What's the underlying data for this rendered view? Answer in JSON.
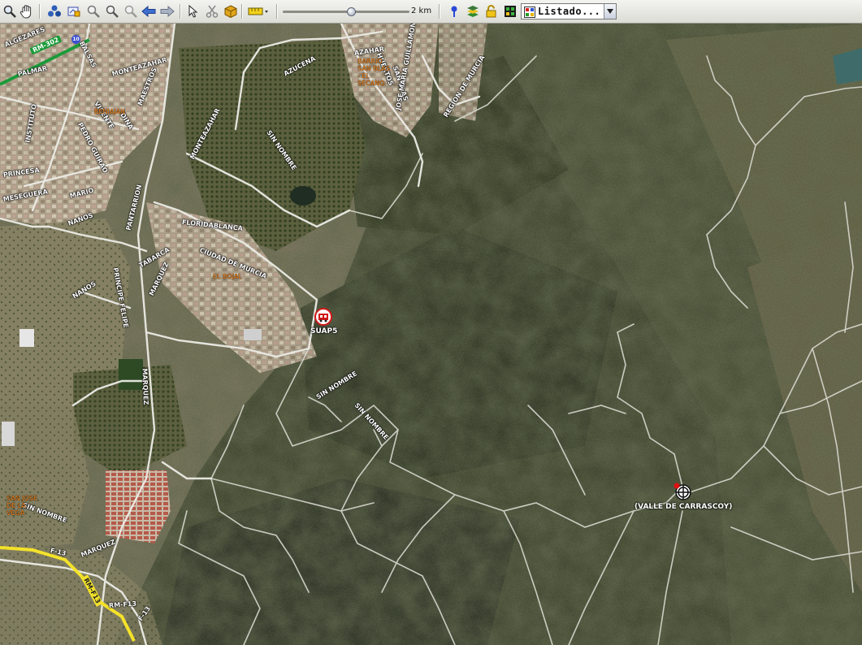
{
  "toolbar": {
    "tools": [
      "zoom-tool-icon",
      "pan-hand-icon",
      "layers-icon",
      "edit-map-icon",
      "zoom-in-icon",
      "zoom-out-icon",
      "zoom-extent-icon",
      "back-arrow-icon",
      "forward-arrow-icon",
      "pointer-icon",
      "scissors-icon",
      "package-icon",
      "ruler-icon"
    ],
    "scale_label": "2 km",
    "scale_slider_fraction": 0.54,
    "tools_right": [
      "pin-icon",
      "layers-stack-icon",
      "lock-icon",
      "grid-icon",
      "listing-icon"
    ],
    "dropdown": {
      "selected": "Listado..."
    }
  },
  "colors": {
    "toolbar_bg": "#dcdcd6",
    "road_white": "#e8e8e8",
    "road_yellow": "#f4e22a",
    "road_green": "#1b9a3a",
    "place_orange": "#ff8a1a"
  },
  "map": {
    "streets": [
      "ALGEZARES",
      "BALSAS",
      "PALMAR",
      "MONTEAZAHAR",
      "AZUCENA",
      "AZAHAR",
      "HUERTOS",
      "SAN BLAS",
      "JOSE MARIA GUILLAMON",
      "REGION DE MURCIA",
      "PEDRO GUIRAO",
      "VICENTE",
      "DINA",
      "MAESTROS",
      "INSTITUTO",
      "PRINCESA",
      "MESEGUERA",
      "MONTEAZAHAR",
      "SIN NOMBRE",
      "NANOS",
      "MARIO",
      "FLORIDABLANCA",
      "CIUDAD DE MURCIA",
      "PANTARRION",
      "PRINCIPE FELIPE",
      "TABARCA",
      "MARQUEZ",
      "NANOS",
      "MARQUEZ",
      "SIN NOMBRE",
      "SIN NOMBRE",
      "SIN NOMBRE",
      "F-13",
      "MARQUEZ",
      "RM-F13",
      "F-13",
      "RM-F13"
    ],
    "places": [
      "BARRIO SAN BLAS - EL SECANO",
      "BENIAJAN",
      "EL BOJAL",
      "SAN JOSE DE LA VEGA"
    ],
    "road_shield": "RM-302",
    "route_number": "10",
    "markers": [
      {
        "label": "SUAP5",
        "icon": "ambulance-icon"
      },
      {
        "label": "(VALLE DE CARRASCOY)",
        "icon": "crosshair-target-icon"
      }
    ]
  }
}
